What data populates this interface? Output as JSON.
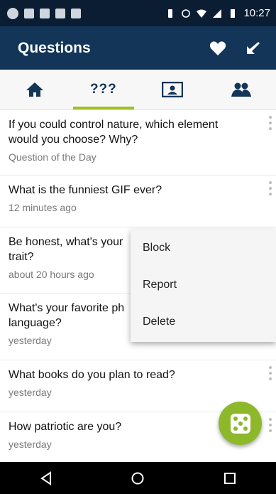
{
  "status_bar": {
    "time": "10:27"
  },
  "app_bar": {
    "title": "Questions"
  },
  "tabs": [
    {
      "name": "home",
      "icon": "home-icon",
      "selected": false
    },
    {
      "name": "questions",
      "label": "???",
      "selected": true
    },
    {
      "name": "profile",
      "icon": "profile-icon",
      "selected": false
    },
    {
      "name": "friends",
      "icon": "friends-icon",
      "selected": false
    }
  ],
  "questions": [
    {
      "text": "If you could control nature, which element would you choose? Why?",
      "meta": "Question of the Day"
    },
    {
      "text": "What is the funniest GIF ever?",
      "meta": "12 minutes ago"
    },
    {
      "text": "Be honest, what's your trait?",
      "meta": "about 20 hours ago"
    },
    {
      "text": "What's your favorite ph language?",
      "meta": "yesterday"
    },
    {
      "text": "What books do you plan to read?",
      "meta": "yesterday"
    },
    {
      "text": "How patriotic are you?",
      "meta": "yesterday"
    }
  ],
  "context_menu": {
    "items": [
      "Block",
      "Report",
      "Delete"
    ]
  },
  "colors": {
    "status_bar": "#0b1d33",
    "app_bar": "#123558",
    "accent": "#9cc21c",
    "fab": "#8db82a"
  }
}
